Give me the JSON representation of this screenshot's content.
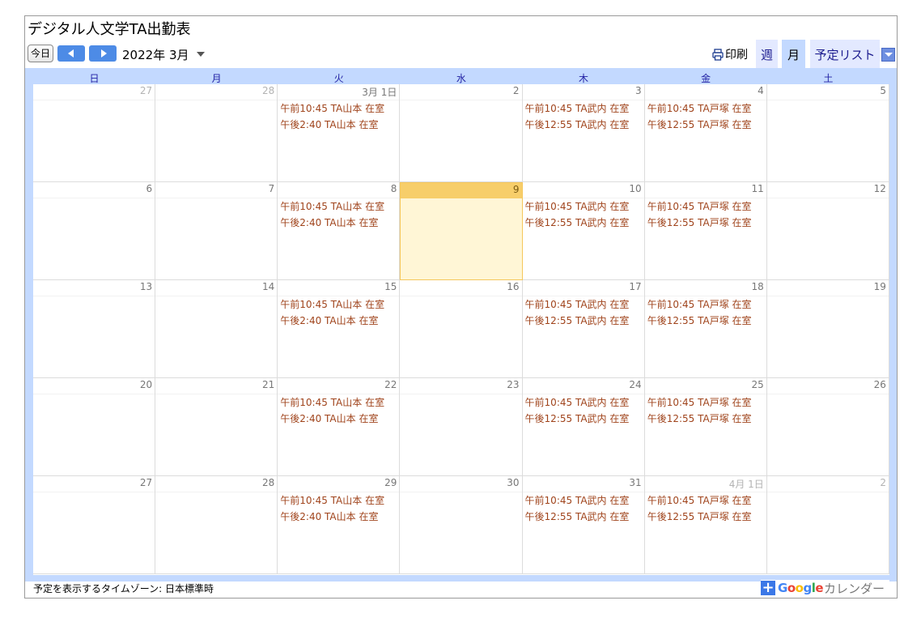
{
  "title": "デジタル人文学TA出勤表",
  "toolbar": {
    "today_label": "今日",
    "month_label": "2022年 3月",
    "print_label": "印刷",
    "tabs": [
      "週",
      "月",
      "予定リスト"
    ]
  },
  "weekdays": [
    "日",
    "月",
    "火",
    "水",
    "木",
    "金",
    "土"
  ],
  "weeks": [
    [
      {
        "date": "27",
        "other": true
      },
      {
        "date": "28",
        "other": true
      },
      {
        "date": "3月 1日",
        "events": [
          "午前10:45 TA山本 在室",
          "午後2:40 TA山本 在室"
        ]
      },
      {
        "date": "2"
      },
      {
        "date": "3",
        "events": [
          "午前10:45 TA武内 在室",
          "午後12:55 TA武内 在室"
        ]
      },
      {
        "date": "4",
        "events": [
          "午前10:45 TA戸塚 在室",
          "午後12:55 TA戸塚 在室"
        ]
      },
      {
        "date": "5"
      }
    ],
    [
      {
        "date": "6"
      },
      {
        "date": "7"
      },
      {
        "date": "8",
        "events": [
          "午前10:45 TA山本 在室",
          "午後2:40 TA山本 在室"
        ]
      },
      {
        "date": "9",
        "today": true
      },
      {
        "date": "10",
        "events": [
          "午前10:45 TA武内 在室",
          "午後12:55 TA武内 在室"
        ]
      },
      {
        "date": "11",
        "events": [
          "午前10:45 TA戸塚 在室",
          "午後12:55 TA戸塚 在室"
        ]
      },
      {
        "date": "12"
      }
    ],
    [
      {
        "date": "13"
      },
      {
        "date": "14"
      },
      {
        "date": "15",
        "events": [
          "午前10:45 TA山本 在室",
          "午後2:40 TA山本 在室"
        ]
      },
      {
        "date": "16"
      },
      {
        "date": "17",
        "events": [
          "午前10:45 TA武内 在室",
          "午後12:55 TA武内 在室"
        ]
      },
      {
        "date": "18",
        "events": [
          "午前10:45 TA戸塚 在室",
          "午後12:55 TA戸塚 在室"
        ]
      },
      {
        "date": "19"
      }
    ],
    [
      {
        "date": "20"
      },
      {
        "date": "21"
      },
      {
        "date": "22",
        "events": [
          "午前10:45 TA山本 在室",
          "午後2:40 TA山本 在室"
        ]
      },
      {
        "date": "23"
      },
      {
        "date": "24",
        "events": [
          "午前10:45 TA武内 在室",
          "午後12:55 TA武内 在室"
        ]
      },
      {
        "date": "25",
        "events": [
          "午前10:45 TA戸塚 在室",
          "午後12:55 TA戸塚 在室"
        ]
      },
      {
        "date": "26"
      }
    ],
    [
      {
        "date": "27"
      },
      {
        "date": "28"
      },
      {
        "date": "29",
        "events": [
          "午前10:45 TA山本 在室",
          "午後2:40 TA山本 在室"
        ]
      },
      {
        "date": "30"
      },
      {
        "date": "31",
        "events": [
          "午前10:45 TA武内 在室",
          "午後12:55 TA武内 在室"
        ]
      },
      {
        "date": "4月 1日",
        "other": true,
        "events": [
          "午前10:45 TA戸塚 在室",
          "午後12:55 TA戸塚 在室"
        ]
      },
      {
        "date": "2",
        "other": true
      }
    ]
  ],
  "footer": {
    "timezone": "予定を表示するタイムゾーン: 日本標準時"
  },
  "badge": {
    "google": "Google",
    "calendar": "カレンダー",
    "google_colors": [
      "#4285f4",
      "#ea4335",
      "#fbbc05",
      "#4285f4",
      "#34a853",
      "#ea4335"
    ]
  },
  "colors": {
    "accent": "#4d8be6",
    "event_text": "#a0441c",
    "today_bg": "#fff6d6",
    "today_header": "#f7ce6a"
  }
}
